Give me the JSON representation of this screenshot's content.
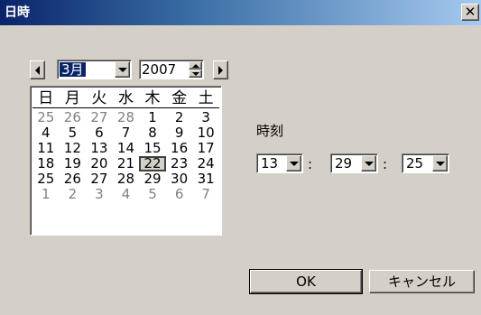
{
  "window": {
    "title": "日時",
    "close_glyph": "✕"
  },
  "month_select": {
    "value": "3月"
  },
  "year_spin": {
    "value": "2007"
  },
  "calendar": {
    "weekdays": [
      "日",
      "月",
      "火",
      "水",
      "木",
      "金",
      "土"
    ],
    "weeks": [
      [
        "25",
        "26",
        "27",
        "28",
        "1",
        "2",
        "3"
      ],
      [
        "4",
        "5",
        "6",
        "7",
        "8",
        "9",
        "10"
      ],
      [
        "11",
        "12",
        "13",
        "14",
        "15",
        "16",
        "17"
      ],
      [
        "18",
        "19",
        "20",
        "21",
        "22",
        "23",
        "24"
      ],
      [
        "25",
        "26",
        "27",
        "28",
        "29",
        "30",
        "31"
      ],
      [
        "1",
        "2",
        "3",
        "4",
        "5",
        "6",
        "7"
      ]
    ],
    "other_month_flags": [
      [
        true,
        true,
        true,
        true,
        false,
        false,
        false
      ],
      [
        false,
        false,
        false,
        false,
        false,
        false,
        false
      ],
      [
        false,
        false,
        false,
        false,
        false,
        false,
        false
      ],
      [
        false,
        false,
        false,
        false,
        false,
        false,
        false
      ],
      [
        false,
        false,
        false,
        false,
        false,
        false,
        false
      ],
      [
        true,
        true,
        true,
        true,
        true,
        true,
        true
      ]
    ],
    "selected_day": "22"
  },
  "time": {
    "label": "時刻",
    "hour": "13",
    "minute": "29",
    "second": "25",
    "separator": ":"
  },
  "buttons": {
    "ok": "OK",
    "cancel": "キャンセル"
  }
}
